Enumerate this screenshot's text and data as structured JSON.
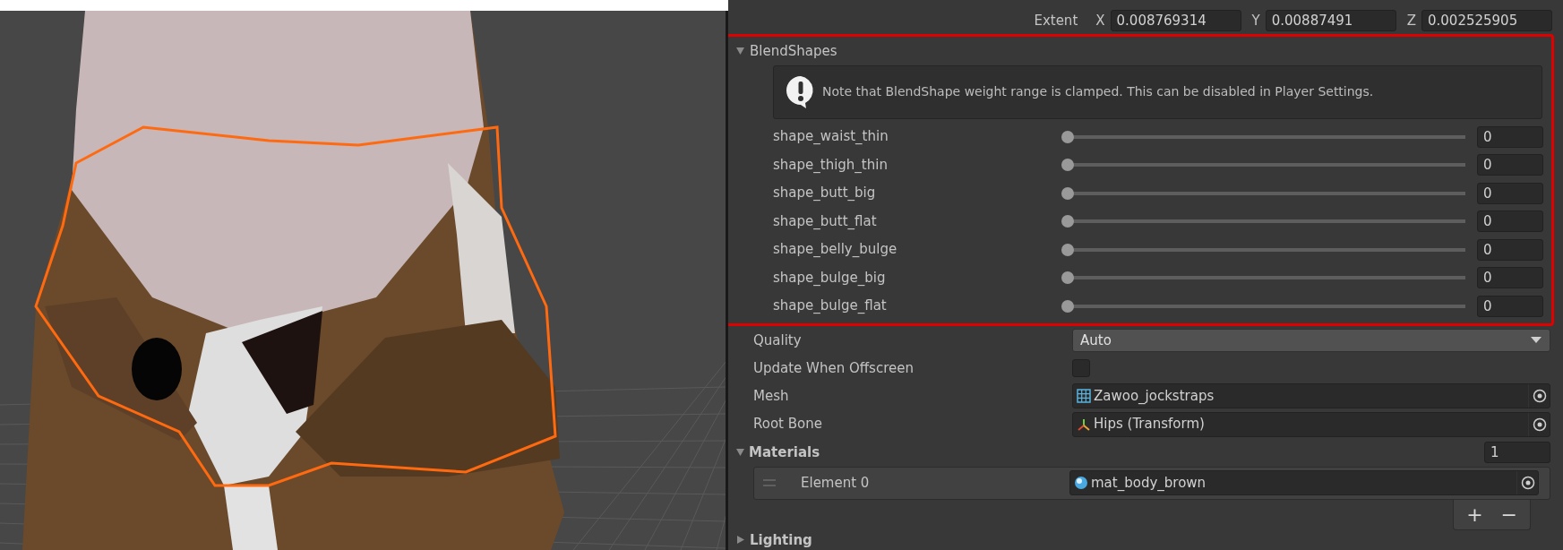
{
  "extent": {
    "label": "Extent",
    "fields": [
      {
        "axis": "X",
        "value": "0.008769314"
      },
      {
        "axis": "Y",
        "value": "0.00887491"
      },
      {
        "axis": "Z",
        "value": "0.002525905"
      }
    ]
  },
  "blendshapes": {
    "title": "BlendShapes",
    "expanded": true,
    "highlighted": true,
    "note": "Note that BlendShape weight range is clamped. This can be disabled in Player Settings.",
    "shapes": [
      {
        "name": "shape_waist_thin",
        "level": 0,
        "value": "0"
      },
      {
        "name": "shape_thigh_thin",
        "level": 0,
        "value": "0"
      },
      {
        "name": "shape_butt_big",
        "level": 0,
        "value": "0"
      },
      {
        "name": "shape_butt_flat",
        "level": 0,
        "value": "0"
      },
      {
        "name": "shape_belly_bulge",
        "level": 0,
        "value": "0"
      },
      {
        "name": "shape_bulge_big",
        "level": 0,
        "value": "0"
      },
      {
        "name": "shape_bulge_flat",
        "level": 0,
        "value": "0"
      }
    ]
  },
  "properties": [
    {
      "kind": "dropdown",
      "label": "Quality",
      "value": "Auto"
    },
    {
      "kind": "checkbox",
      "label": "Update When Offscreen",
      "checked": false
    },
    {
      "kind": "object",
      "label": "Mesh",
      "value": "Zawoo_jockstraps"
    },
    {
      "kind": "object",
      "label": "Root Bone",
      "value": "Hips (Transform)"
    }
  ],
  "materials": {
    "title": "Materials",
    "expanded": true,
    "count": "1",
    "elements": [
      {
        "label": "Element 0",
        "value": "mat_body_brown"
      }
    ],
    "add": "+",
    "remove": "−"
  },
  "lighting": {
    "title": "Lighting",
    "expanded": false
  }
}
